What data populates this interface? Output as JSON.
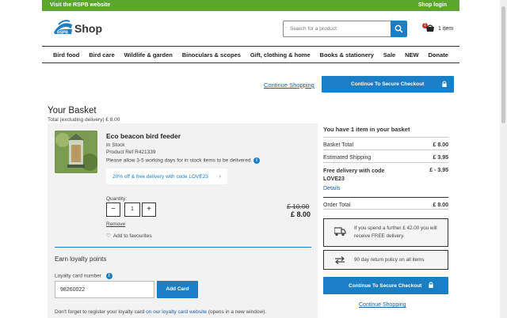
{
  "topbar": {
    "rspb_link": "Visit the RSPB website",
    "login": "Shop login"
  },
  "logo": {
    "text": "Shop",
    "badge": "RSPB"
  },
  "search": {
    "placeholder": "Search for a product"
  },
  "cart": {
    "count": "1",
    "label": "1 item"
  },
  "nav": [
    "Bird food",
    "Bird care",
    "Wildlife & garden",
    "Binoculars & scopes",
    "Gift, clothing & home",
    "Books & stationery",
    "Sale",
    "NEW",
    "Donate"
  ],
  "actions": {
    "continue_shopping": "Continue Shopping",
    "checkout": "Continue To Secure Checkout"
  },
  "basket": {
    "title": "Your Basket",
    "total_excl": "Total (excluding delivery) £ 8.00",
    "item": {
      "name": "Eco beacon bird feeder",
      "stock": "In Stock",
      "ref": "Product Ref R421339",
      "delivery_note": "Please allow 3-5 working days for in stock items to be delivered.",
      "promo": "20% off & free delivery with code LOVE23",
      "quantity_label": "Quantity:",
      "quantity": "1",
      "old_price": "£ 10.00",
      "price": "£ 8.00",
      "remove": "Remove",
      "favourite": "Add to favourites"
    },
    "loyalty": {
      "heading": "Earn loyalty points",
      "card_label": "Loyalty card number",
      "card_value": "98260022",
      "add_button": "Add Card",
      "register_prefix": "Don't forget to register your loyalty card",
      "register_link": "on our loyalty card website",
      "register_suffix": "(opens in a new window)."
    }
  },
  "summary": {
    "heading": "You have 1 item in your basket",
    "rows": [
      {
        "label": "Basket Total",
        "value": "£ 8.00"
      },
      {
        "label": "Estimated Shipping",
        "value": "£ 3.95"
      },
      {
        "label": "Free delivery with code LOVE23",
        "value": "£ - 3.95"
      },
      {
        "label": "Order Total",
        "value": "£ 8.00"
      }
    ],
    "details_link": "Details",
    "free_delivery_msg": "If you spend a further £ 42.00 you will receive FREE delivery.",
    "returns_msg": "90 day return policy on all items"
  }
}
